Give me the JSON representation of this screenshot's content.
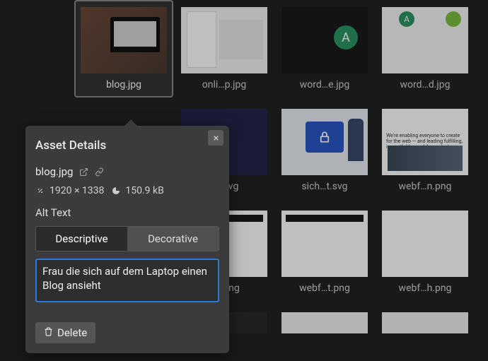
{
  "grid": {
    "items": [
      {
        "caption": "blog.jpg",
        "selected": true,
        "thumb": "t-blog"
      },
      {
        "caption": "onli…p.jpg",
        "thumb": "t-onli"
      },
      {
        "caption": "word…e.jpg",
        "thumb": "t-worde"
      },
      {
        "caption": "word…d.jpg",
        "thumb": "t-wordd"
      },
      {
        "caption": "…y.svg",
        "thumb": "t-svg"
      },
      {
        "caption": "sich…t.svg",
        "thumb": "t-sec"
      },
      {
        "caption": "webf…n.png",
        "thumb": "t-webn"
      },
      {
        "caption": "…s.png",
        "thumb": "t-tbl"
      },
      {
        "caption": "webf…t.png",
        "thumb": "t-tbl"
      },
      {
        "caption": "webf…h.png",
        "thumb": "t-tbl2"
      }
    ]
  },
  "panel": {
    "title": "Asset Details",
    "filename": "blog.jpg",
    "dimensions": "1920 × 1338",
    "filesize": "150.9 kB",
    "alt_label": "Alt Text",
    "tabs": {
      "descriptive": "Descriptive",
      "decorative": "Decorative",
      "active": "descriptive"
    },
    "alt_value": "Frau die sich auf dem Laptop einen Blog ansieht",
    "delete_label": "Delete"
  },
  "webn_text": "We're enabling everyone to create for the web — and leading fulfilling, impactful lives while we do it."
}
